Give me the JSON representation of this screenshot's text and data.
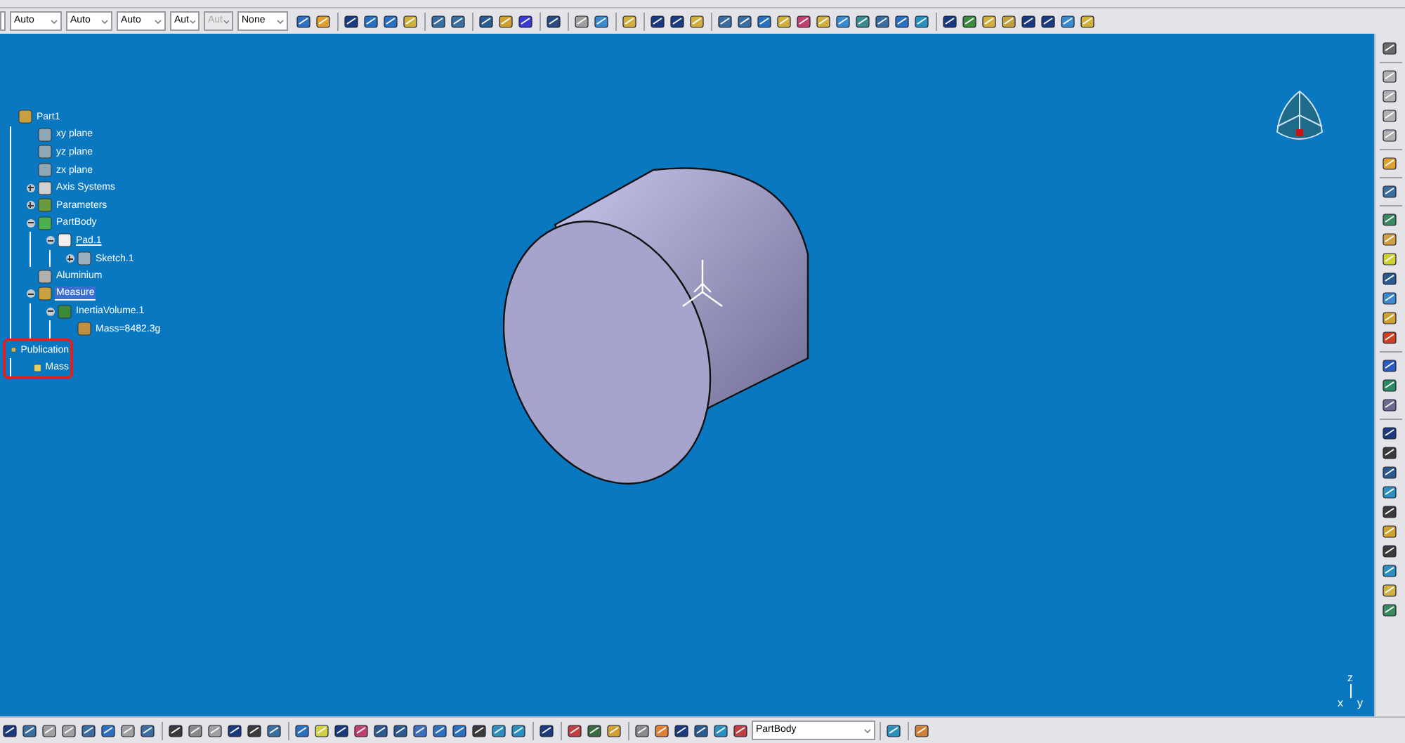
{
  "toolbar": {
    "combos": [
      {
        "value": "Auto",
        "disabled": false
      },
      {
        "value": "Auto",
        "disabled": false
      },
      {
        "value": "Auto",
        "disabled": false
      },
      {
        "value": "Aut",
        "disabled": false
      },
      {
        "value": "Aut",
        "disabled": true
      },
      {
        "value": "None",
        "disabled": false
      }
    ]
  },
  "tree": [
    {
      "label": "Part1",
      "kind": "part",
      "selected": false,
      "in_work": false,
      "children": [
        {
          "label": "xy plane",
          "kind": "plane",
          "selected": false,
          "in_work": false
        },
        {
          "label": "yz plane",
          "kind": "plane",
          "selected": false,
          "in_work": false
        },
        {
          "label": "zx plane",
          "kind": "plane",
          "selected": false,
          "in_work": false
        },
        {
          "label": "Axis Systems",
          "kind": "axis",
          "selected": false,
          "in_work": false,
          "expanded": false
        },
        {
          "label": "Parameters",
          "kind": "parameters",
          "selected": false,
          "in_work": false,
          "expanded": false
        },
        {
          "label": "PartBody",
          "kind": "body",
          "selected": false,
          "in_work": false,
          "expanded": true,
          "children": [
            {
              "label": "Pad.1",
              "kind": "pad",
              "selected": false,
              "in_work": true,
              "expanded": true,
              "children": [
                {
                  "label": "Sketch.1",
                  "kind": "sketch",
                  "selected": false,
                  "in_work": false,
                  "expanded": false
                }
              ]
            }
          ]
        },
        {
          "label": "Aluminium",
          "kind": "material",
          "selected": false,
          "in_work": false
        },
        {
          "label": "Measure",
          "kind": "measure",
          "selected": true,
          "in_work": false,
          "expanded": true,
          "children": [
            {
              "label": "InertiaVolume.1",
              "kind": "inertia",
              "selected": false,
              "in_work": false,
              "expanded": true,
              "children": [
                {
                  "label": "Mass=8482.3g",
                  "kind": "mass",
                  "selected": false,
                  "in_work": false
                }
              ]
            }
          ]
        }
      ]
    },
    {
      "label": "Publication",
      "kind": "publication",
      "selected": false,
      "in_work": false,
      "circled": true,
      "children": [
        {
          "label": "Mass",
          "kind": "published",
          "selected": false,
          "in_work": false
        }
      ]
    }
  ],
  "axis_labels": [
    "z",
    "x",
    "y"
  ],
  "bottom_toolbar": {
    "body_combo": {
      "value": "PartBody"
    }
  }
}
